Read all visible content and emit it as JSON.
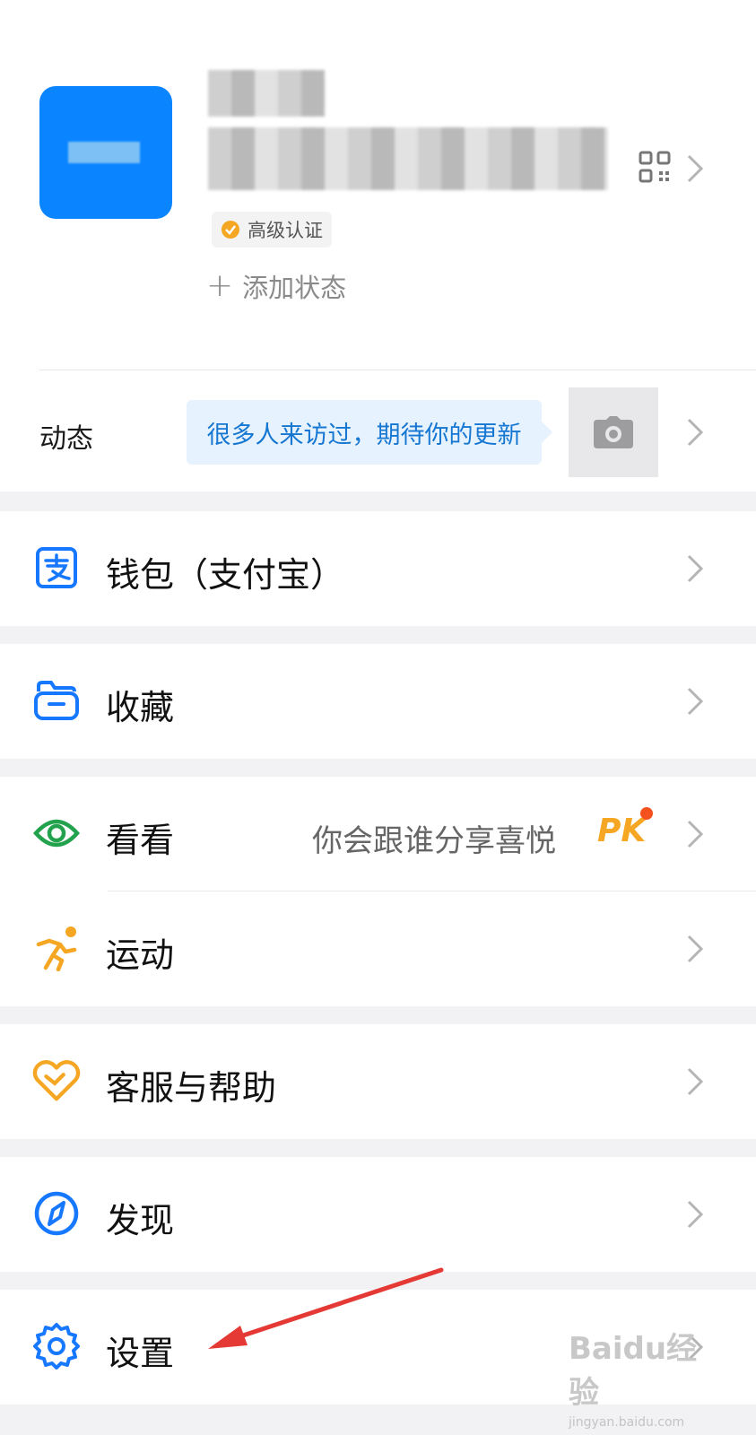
{
  "profile": {
    "badge_label": "高级认证",
    "add_status_label": "添加状态"
  },
  "moments": {
    "label": "动态",
    "bubble_text": "很多人来访过，期待你的更新"
  },
  "menu": {
    "wallet": {
      "label": "钱包（支付宝）",
      "icon": "alipay-icon",
      "color": "#1677ff"
    },
    "favorites": {
      "label": "收藏",
      "icon": "folder-icon",
      "color": "#1677ff"
    },
    "kankan": {
      "label": "看看",
      "hint": "你会跟谁分享喜悦",
      "badge": "PK",
      "icon": "eye-icon",
      "color": "#23a24d"
    },
    "sports": {
      "label": "运动",
      "icon": "runner-icon",
      "color": "#f5a623"
    },
    "support": {
      "label": "客服与帮助",
      "icon": "heart-icon",
      "color": "#f5a623"
    },
    "discover": {
      "label": "发现",
      "icon": "compass-icon",
      "color": "#1677ff"
    },
    "settings": {
      "label": "设置",
      "icon": "gear-icon",
      "color": "#1677ff"
    }
  },
  "annotation": {
    "color": "#e53935"
  },
  "watermark": {
    "brand": "Baidu经验",
    "url": "jingyan.baidu.com"
  }
}
